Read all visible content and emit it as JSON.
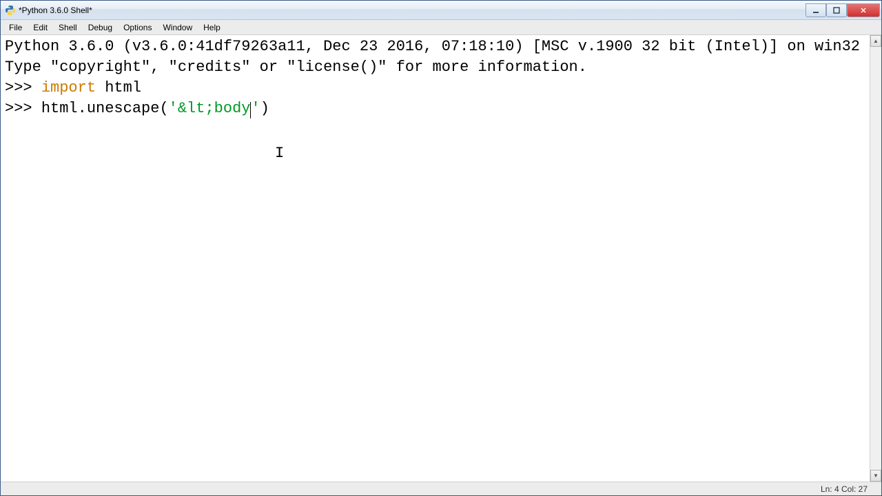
{
  "window": {
    "title": "*Python 3.6.0 Shell*"
  },
  "menu": {
    "file": "File",
    "edit": "Edit",
    "shell": "Shell",
    "debug": "Debug",
    "options": "Options",
    "window": "Window",
    "help": "Help"
  },
  "shell": {
    "banner1": "Python 3.6.0 (v3.6.0:41df79263a11, Dec 23 2016, 07:18:10) [MSC v.1900 32 bit (Intel)] on win32",
    "banner2": "Type \"copyright\", \"credits\" or \"license()\" for more information.",
    "prompt": ">>> ",
    "line1_kw": "import",
    "line1_rest": " html",
    "line2_pre": "html.unescape(",
    "line2_str_q1": "'",
    "line2_str_body": "&lt;body",
    "line2_str_q2": "'",
    "line2_post": ")"
  },
  "status": {
    "pos": "Ln: 4  Col: 27"
  }
}
